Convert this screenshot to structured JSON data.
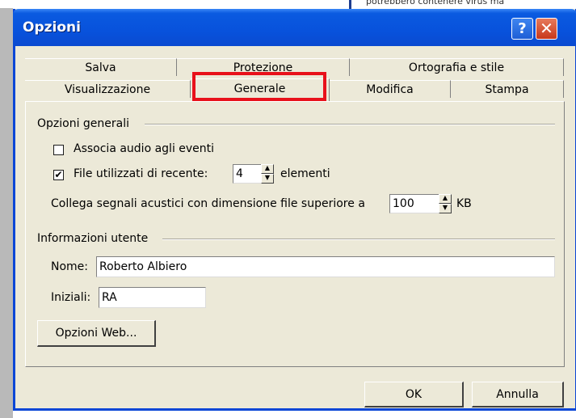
{
  "background": {
    "doc_text": "potrebbero contenere virus ma"
  },
  "window": {
    "title": "Opzioni",
    "help_icon": "?",
    "close_icon": "✕"
  },
  "tabs": {
    "row1": [
      "Salva",
      "Protezione",
      "Ortografia e stile"
    ],
    "row2": [
      "Visualizzazione",
      "Generale",
      "Modifica",
      "Stampa"
    ],
    "active": "Generale"
  },
  "general": {
    "group_label": "Opzioni generali",
    "audio": {
      "label": "Associa audio agli eventi",
      "checked": false
    },
    "recent": {
      "label": "File utilizzati di recente:",
      "value": "4",
      "suffix": "elementi",
      "checked": true,
      "check_glyph": "✔"
    },
    "sound_link": {
      "label": "Collega segnali acustici con dimensione file superiore a",
      "value": "100",
      "unit": "KB"
    }
  },
  "user": {
    "group_label": "Informazioni utente",
    "name_label": "Nome:",
    "name_value": "Roberto Albiero",
    "initials_label": "Iniziali:",
    "initials_value": "RA"
  },
  "buttons": {
    "web_options": "Opzioni Web...",
    "ok": "OK",
    "cancel": "Annulla"
  },
  "colors": {
    "titlebar": "#0852dc",
    "dialog_bg": "#ece9d8",
    "highlight": "#e8111b"
  }
}
